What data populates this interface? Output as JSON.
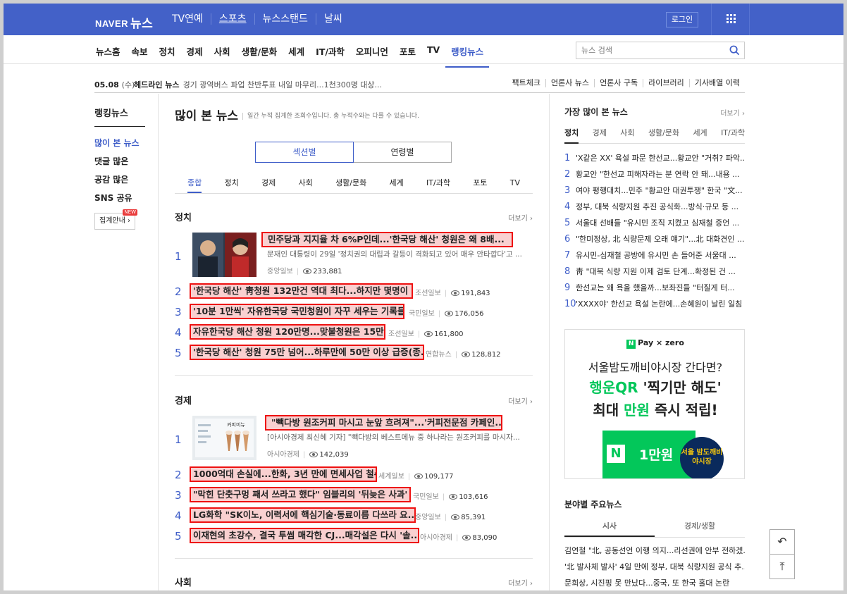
{
  "header": {
    "brand_naver": "NAVER",
    "brand_news": "뉴스",
    "top_links": [
      "TV연예",
      "스포츠",
      "뉴스스탠드",
      "날씨"
    ],
    "login_label": "로그인"
  },
  "nav": {
    "items": [
      "뉴스홈",
      "속보",
      "정치",
      "경제",
      "사회",
      "생활/문화",
      "세계",
      "IT/과학",
      "오피니언",
      "포토",
      "TV",
      "랭킹뉴스"
    ],
    "active": "랭킹뉴스",
    "search_placeholder": "뉴스 검색"
  },
  "subbar": {
    "date": "05.08",
    "dow": "(수)",
    "headline_label": "헤드라인 뉴스",
    "headline_text": "경기 광역버스 파업 찬반투표 내일 마무리...1천300명 대상...",
    "links": [
      "팩트체크",
      "언론사 뉴스",
      "언론사 구독",
      "라이브러리",
      "기사배열 이력"
    ]
  },
  "left": {
    "heading": "랭킹뉴스",
    "menu": [
      "많이 본 뉴스",
      "댓글 많은",
      "공감 많은",
      "SNS 공유"
    ],
    "active": "많이 본 뉴스",
    "guide_label": "집계안내",
    "guide_new": "NEW"
  },
  "center": {
    "title": "많이 본 뉴스",
    "subtitle": "일간 누적 집계한 조회수입니다. 총 누적수와는 다를 수 있습니다.",
    "segments": [
      "섹션별",
      "연령별"
    ],
    "tabs": [
      "종합",
      "정치",
      "경제",
      "사회",
      "생활/문화",
      "세계",
      "IT/과학",
      "포토",
      "TV"
    ],
    "more_label": "더보기",
    "sections": [
      {
        "name": "정치",
        "items": [
          {
            "rank": "1",
            "title": "민주당과 지지율 차 6%P인데...'한국당 해산' 청원은 왜 8배...",
            "desc": "문재인 대통령이 29일 '정치권의 대립과 갈등이 격화되고 있어 매우 안타깝다'고 ...",
            "press": "중앙일보",
            "views": "233,881"
          },
          {
            "rank": "2",
            "title": "'한국당 해산' 靑청원 132만건 역대 최다...하지만 몇명이 ...",
            "press": "조선일보",
            "views": "191,843"
          },
          {
            "rank": "3",
            "title": "'10분 1만씩' 자유한국당 국민청원이 자꾸 세우는 기록들",
            "press": "국민일보",
            "views": "176,056"
          },
          {
            "rank": "4",
            "title": "자유한국당 해산 청원 120만명...맞불청원은 15만명",
            "press": "조선일보",
            "views": "161,800"
          },
          {
            "rank": "5",
            "title": "'한국당 해산' 청원 75만 넘어...하루만에 50만 이상 급증(종...",
            "press": "연합뉴스",
            "views": "128,812"
          }
        ]
      },
      {
        "name": "경제",
        "items": [
          {
            "rank": "1",
            "title": "\"빽다방 원조커피 마시고 눈앞 흐려져\"...'커피전문점 카페인...",
            "desc": "[아시아경제 최신혜 기자] \"빽다방의 베스트메뉴 중 하나라는 원조커피를 마시자...",
            "press": "아시아경제",
            "views": "142,039",
            "thumb_text": "커피미뉴"
          },
          {
            "rank": "2",
            "title": "1000억대 손실에...한화, 3년 만에 면세사업 철수",
            "press": "세계일보",
            "views": "109,177"
          },
          {
            "rank": "3",
            "title": "\"막힌 단춧구멍 째서 쓰라고 했다\" 임블리의 '뒤늦은 사과'",
            "press": "국민일보",
            "views": "103,616"
          },
          {
            "rank": "4",
            "title": "LG화학 \"SK이노, 이력서에 핵심기술·동료이름 다쓰라 요...",
            "press": "중앙일보",
            "views": "85,391"
          },
          {
            "rank": "5",
            "title": "이재현의 초강수, 결국 투썸 매각한 CJ...매각설은 다시 '솔...",
            "press": "아시아경제",
            "views": "83,090"
          }
        ]
      },
      {
        "name": "사회"
      }
    ]
  },
  "right": {
    "heading": "가장 많이 본 뉴스",
    "more_label": "더보기",
    "tabs": [
      "정치",
      "경제",
      "사회",
      "생활/문화",
      "세계",
      "IT/과학"
    ],
    "list": [
      {
        "rank": "1",
        "text": "'X같은 XX' 욕설 파문 한선교...황교안 \"거취? 파악..."
      },
      {
        "rank": "2",
        "text": "황교안 \"한선교 피해자라는 분 연락 안 돼...내용 ..."
      },
      {
        "rank": "3",
        "text": "여야 평행대치...민주 \"황교안 대권투쟁\" 한국 \"文..."
      },
      {
        "rank": "4",
        "text": "정부, 대북 식량지원 추진 공식화...방식·규모 등 ..."
      },
      {
        "rank": "5",
        "text": "서울대 선배들 \"유시민 조직 지켰고 심재철 증언 ..."
      },
      {
        "rank": "6",
        "text": "\"한미정상, 北 식량문제 오래 얘기\"...北 대화견인 ..."
      },
      {
        "rank": "7",
        "text": "유시민-심재철 공방에 유시민 손 들어준 서울대 ..."
      },
      {
        "rank": "8",
        "text": "靑 \"대북 식량 지원 이제 검토 단계...확정된 건 ..."
      },
      {
        "rank": "9",
        "text": "한선교는 왜 욕을 했을까...보좌진들 \"터질게 터..."
      },
      {
        "rank": "10",
        "text": "'XXXX야' 한선교 욕설 논란에...손혜원이 날린 일침"
      }
    ],
    "ad": {
      "brand_pay": "Pay",
      "brand_zero": "zero",
      "line1": "서울밤도깨비야시장 간다면?",
      "line2_a": "행운QR",
      "line2_b": " '찍기만 해도'",
      "line3_a": "최대 ",
      "line3_b": "만원",
      "line3_c": " 즉시 적립!",
      "card_amount": "1만원",
      "badge_text": "서울 밤도깨비 야시장"
    },
    "field": {
      "heading": "분야별 주요뉴스",
      "tabs": [
        "시사",
        "경제/생활"
      ],
      "list": [
        "김연철 \"北, 공동선언 이행 의지...리선권에 안부 전하겠...",
        "'北 발사체 발사' 4일 만에 정부, 대북 식량지원 공식 추...",
        "문희상, 시진핑 못 만났다...중국, 또 한국 홀대 논란"
      ]
    }
  },
  "float_buttons": {
    "undo_icon": "↶",
    "top_icon": "⤒"
  }
}
